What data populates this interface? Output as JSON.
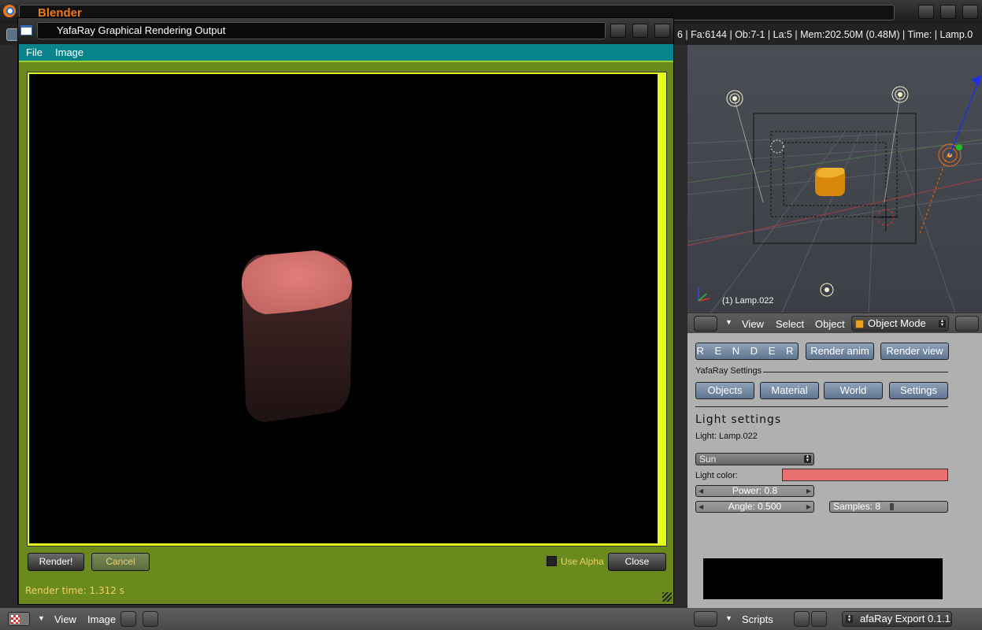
{
  "blender": {
    "title": "Blender",
    "stats": "6 | Fa:6144 | Ob:7-1 | La:5  | Mem:202.50M (0.48M)  | Time: | Lamp.0"
  },
  "yafaray_window": {
    "title": "YafaRay Graphical Rendering Output",
    "menu": [
      "File",
      "Image"
    ],
    "render_button": "Render!",
    "cancel_button": "Cancel",
    "use_alpha_label": "Use Alpha",
    "use_alpha_checked": false,
    "close_button": "Close",
    "render_time": "Render time: 1.312 s",
    "frame_color": "#e6ff1a",
    "panel_color": "#6a8a1e",
    "menubar_color": "#08848a"
  },
  "viewport": {
    "object_label": "(1) Lamp.022",
    "header": {
      "menus": [
        "View",
        "Select",
        "Object"
      ],
      "mode": "Object Mode"
    }
  },
  "script_panel": {
    "render_buttons": [
      "R E N D E R",
      "Render anim",
      "Render view"
    ],
    "settings_label": "YafaRay Settings",
    "tabs": [
      "Objects",
      "Material",
      "World",
      "Settings"
    ],
    "light_settings_title": "Light settings",
    "light_name": "Light: Lamp.022",
    "light_type": "Sun",
    "light_color_label": "Light color:",
    "light_color": "#e87070",
    "power": "Power: 0.8",
    "angle": "Angle: 0.500",
    "samples": "Samples: 8"
  },
  "script_footer": {
    "menu": "Scripts",
    "script_name": "afaRay Export 0.1.1"
  },
  "image_footer": {
    "menus": [
      "View",
      "Image"
    ]
  }
}
